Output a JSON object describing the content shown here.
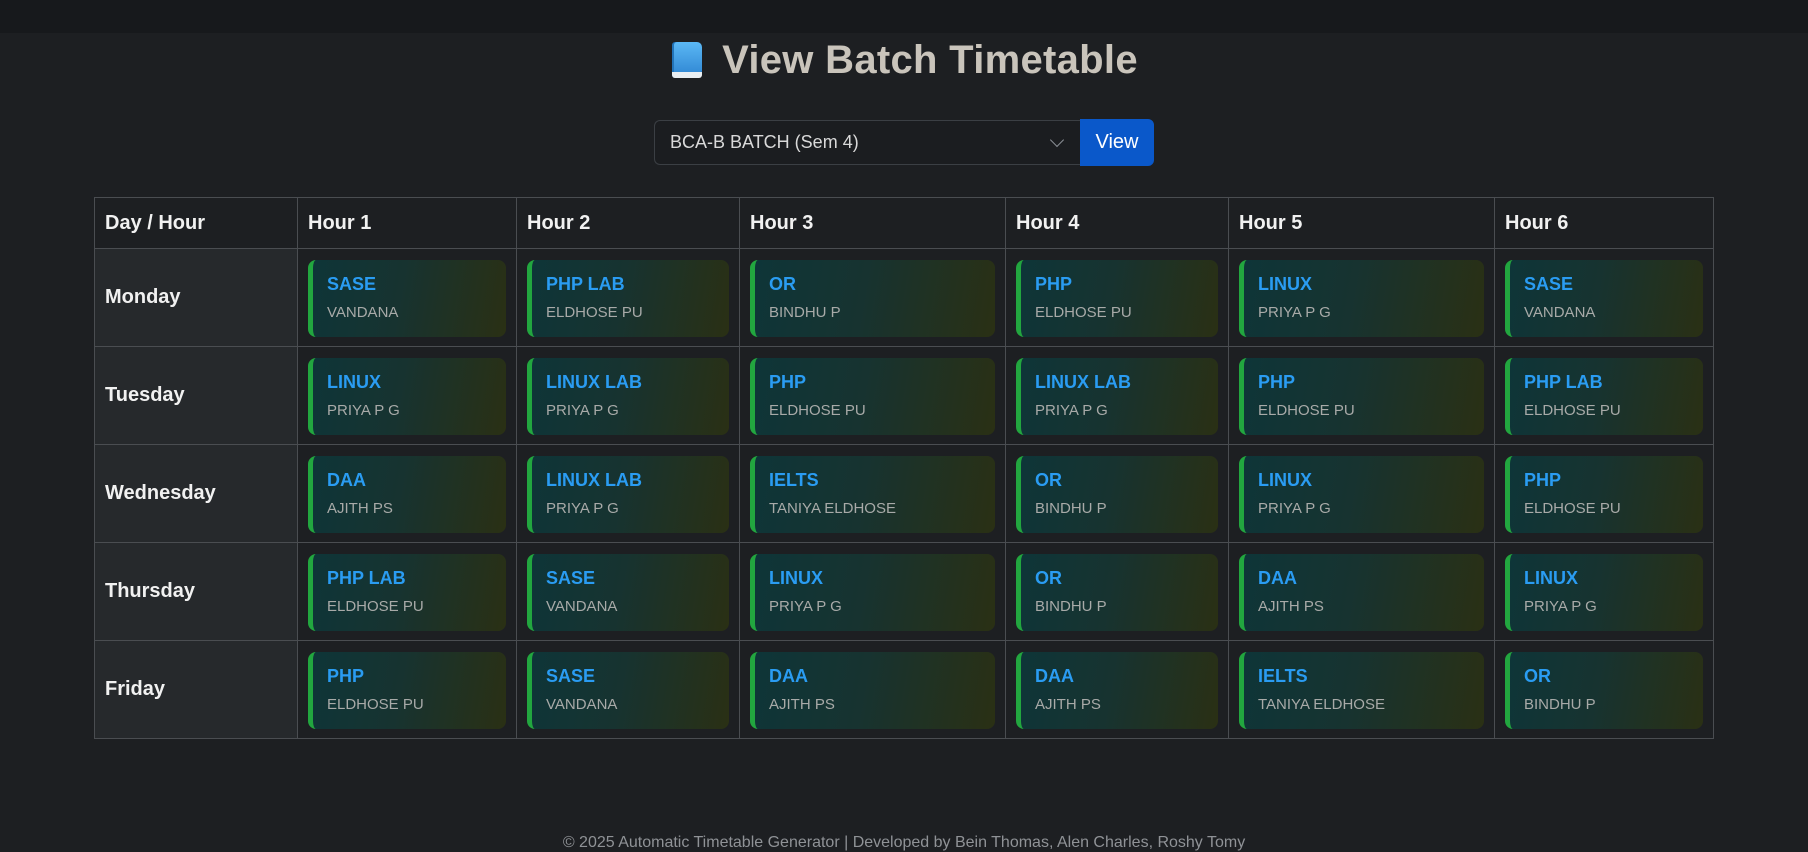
{
  "header": {
    "title": "View Batch Timetable",
    "icon": "blue-book-icon"
  },
  "batch_select": {
    "selected": "BCA-B BATCH (Sem 4)"
  },
  "view_button": {
    "label": "View"
  },
  "table": {
    "corner": "Day / Hour",
    "hours": [
      "Hour 1",
      "Hour 2",
      "Hour 3",
      "Hour 4",
      "Hour 5",
      "Hour 6"
    ],
    "rows": [
      {
        "day": "Monday",
        "slots": [
          {
            "subject": "SASE",
            "teacher": "VANDANA"
          },
          {
            "subject": "PHP LAB",
            "teacher": "ELDHOSE PU"
          },
          {
            "subject": "OR",
            "teacher": "BINDHU P"
          },
          {
            "subject": "PHP",
            "teacher": "ELDHOSE PU"
          },
          {
            "subject": "LINUX",
            "teacher": "PRIYA P G"
          },
          {
            "subject": "SASE",
            "teacher": "VANDANA"
          }
        ]
      },
      {
        "day": "Tuesday",
        "slots": [
          {
            "subject": "LINUX",
            "teacher": "PRIYA P G"
          },
          {
            "subject": "LINUX LAB",
            "teacher": "PRIYA P G"
          },
          {
            "subject": "PHP",
            "teacher": "ELDHOSE PU"
          },
          {
            "subject": "LINUX LAB",
            "teacher": "PRIYA P G"
          },
          {
            "subject": "PHP",
            "teacher": "ELDHOSE PU"
          },
          {
            "subject": "PHP LAB",
            "teacher": "ELDHOSE PU"
          }
        ]
      },
      {
        "day": "Wednesday",
        "slots": [
          {
            "subject": "DAA",
            "teacher": "AJITH PS"
          },
          {
            "subject": "LINUX LAB",
            "teacher": "PRIYA P G"
          },
          {
            "subject": "IELTS",
            "teacher": "TANIYA ELDHOSE"
          },
          {
            "subject": "OR",
            "teacher": "BINDHU P"
          },
          {
            "subject": "LINUX",
            "teacher": "PRIYA P G"
          },
          {
            "subject": "PHP",
            "teacher": "ELDHOSE PU"
          }
        ]
      },
      {
        "day": "Thursday",
        "slots": [
          {
            "subject": "PHP LAB",
            "teacher": "ELDHOSE PU"
          },
          {
            "subject": "SASE",
            "teacher": "VANDANA"
          },
          {
            "subject": "LINUX",
            "teacher": "PRIYA P G"
          },
          {
            "subject": "OR",
            "teacher": "BINDHU P"
          },
          {
            "subject": "DAA",
            "teacher": "AJITH PS"
          },
          {
            "subject": "LINUX",
            "teacher": "PRIYA P G"
          }
        ]
      },
      {
        "day": "Friday",
        "slots": [
          {
            "subject": "PHP",
            "teacher": "ELDHOSE PU"
          },
          {
            "subject": "SASE",
            "teacher": "VANDANA"
          },
          {
            "subject": "DAA",
            "teacher": "AJITH PS"
          },
          {
            "subject": "DAA",
            "teacher": "AJITH PS"
          },
          {
            "subject": "IELTS",
            "teacher": "TANIYA ELDHOSE"
          },
          {
            "subject": "OR",
            "teacher": "BINDHU P"
          }
        ]
      }
    ]
  },
  "footer": {
    "text": "© 2025 Automatic Timetable Generator | Developed by Bein Thomas, Alen Charles, Roshy Tomy"
  },
  "colors": {
    "background": "#1d1f22",
    "accent_button": "#0a58ca",
    "subject_text": "#2a9cf2",
    "slot_border": "#22a63f"
  }
}
